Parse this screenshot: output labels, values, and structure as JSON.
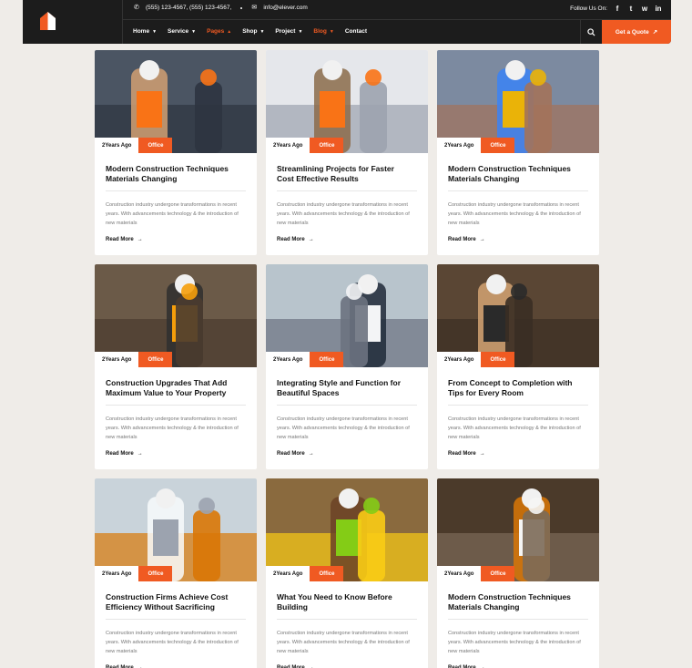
{
  "header": {
    "phone": "(555) 123-4567,  (555) 123-4567,",
    "email": "info@elever.com",
    "follow_label": "Follow Us On:",
    "social": [
      "f",
      "t",
      "w",
      "in"
    ],
    "nav": [
      {
        "label": "Home",
        "active": false
      },
      {
        "label": "Service",
        "active": false
      },
      {
        "label": "Pages",
        "active": true
      },
      {
        "label": "Shop",
        "active": false
      },
      {
        "label": "Project",
        "active": false
      },
      {
        "label": "Blog",
        "active": true
      },
      {
        "label": "Contact",
        "active": false
      }
    ],
    "cta": "Get a Quote",
    "accent": "#f05a22"
  },
  "posts": [
    {
      "date": "2Years Ago",
      "category": "Office",
      "title": "Modern Construction Techniques Materials Changing",
      "excerpt": "Construction industry undergone transformations in recent years. With advancements technology & the introduction of new materials",
      "link": "Read More"
    },
    {
      "date": "2Years Ago",
      "category": "Office",
      "title": "Streamlining Projects for Faster Cost Effective Results",
      "excerpt": "Construction industry undergone transformations in recent years. With advancements technology & the introduction of new materials",
      "link": "Read More"
    },
    {
      "date": "2Years Ago",
      "category": "Office",
      "title": "Modern Construction Techniques Materials Changing",
      "excerpt": "Construction industry undergone transformations in recent years. With advancements technology & the introduction of new materials",
      "link": "Read More"
    },
    {
      "date": "2Years Ago",
      "category": "Office",
      "title": "Construction Upgrades That Add Maximum Value to Your Property",
      "excerpt": "Construction industry undergone transformations in recent years. With advancements technology & the introduction of new materials",
      "link": "Read More"
    },
    {
      "date": "2Years Ago",
      "category": "Office",
      "title": "Integrating Style and Function for Beautiful Spaces",
      "excerpt": "Construction industry undergone transformations in recent years. With advancements technology & the introduction of new materials",
      "link": "Read More"
    },
    {
      "date": "2Years Ago",
      "category": "Office",
      "title": "From Concept to Completion with Tips for Every Room",
      "excerpt": "Construction industry undergone transformations in recent years. With advancements technology & the introduction of new materials",
      "link": "Read More"
    },
    {
      "date": "2Years Ago",
      "category": "Office",
      "title": "Construction Firms Achieve Cost Efficiency Without Sacrificing",
      "excerpt": "Construction industry undergone transformations in recent years. With advancements technology & the introduction of new materials",
      "link": "Read More"
    },
    {
      "date": "2Years Ago",
      "category": "Office",
      "title": "What You Need to Know Before Building",
      "excerpt": "Construction industry undergone transformations in recent years. With advancements technology & the introduction of new materials",
      "link": "Read More"
    },
    {
      "date": "2Years Ago",
      "category": "Office",
      "title": "Modern Construction Techniques Materials Changing",
      "excerpt": "Construction industry undergone transformations in recent years. With advancements technology & the introduction of new materials",
      "link": "Read More"
    }
  ]
}
